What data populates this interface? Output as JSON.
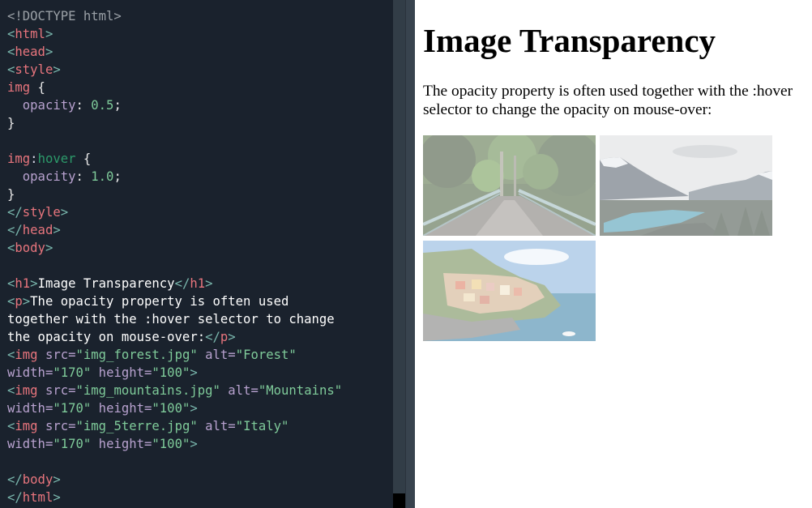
{
  "editor": {
    "lines": [
      [
        {
          "c": "doc",
          "t": "<!DOCTYPE html>"
        }
      ],
      [
        {
          "c": "br",
          "t": "<"
        },
        {
          "c": "tag",
          "t": "html"
        },
        {
          "c": "br",
          "t": ">"
        }
      ],
      [
        {
          "c": "br",
          "t": "<"
        },
        {
          "c": "tag",
          "t": "head"
        },
        {
          "c": "br",
          "t": ">"
        }
      ],
      [
        {
          "c": "br",
          "t": "<"
        },
        {
          "c": "tag",
          "t": "style"
        },
        {
          "c": "br",
          "t": ">"
        }
      ],
      [
        {
          "c": "sel",
          "t": "img"
        },
        {
          "c": "punc",
          "t": " {"
        }
      ],
      [
        {
          "c": "prop",
          "t": "  opacity"
        },
        {
          "c": "punc",
          "t": ": "
        },
        {
          "c": "val",
          "t": "0.5"
        },
        {
          "c": "punc",
          "t": ";"
        }
      ],
      [
        {
          "c": "punc",
          "t": "}"
        }
      ],
      [],
      [
        {
          "c": "sel",
          "t": "img"
        },
        {
          "c": "colon",
          "t": ":"
        },
        {
          "c": "pseudo",
          "t": "hover"
        },
        {
          "c": "punc",
          "t": " {"
        }
      ],
      [
        {
          "c": "prop",
          "t": "  opacity"
        },
        {
          "c": "punc",
          "t": ": "
        },
        {
          "c": "val",
          "t": "1.0"
        },
        {
          "c": "punc",
          "t": ";"
        }
      ],
      [
        {
          "c": "punc",
          "t": "}"
        }
      ],
      [
        {
          "c": "br",
          "t": "</"
        },
        {
          "c": "tag",
          "t": "style"
        },
        {
          "c": "br",
          "t": ">"
        }
      ],
      [
        {
          "c": "br",
          "t": "</"
        },
        {
          "c": "tag",
          "t": "head"
        },
        {
          "c": "br",
          "t": ">"
        }
      ],
      [
        {
          "c": "br",
          "t": "<"
        },
        {
          "c": "tag",
          "t": "body"
        },
        {
          "c": "br",
          "t": ">"
        }
      ],
      [],
      [
        {
          "c": "br",
          "t": "<"
        },
        {
          "c": "tag",
          "t": "h1"
        },
        {
          "c": "br",
          "t": ">"
        },
        {
          "c": "text",
          "t": "Image Transparency"
        },
        {
          "c": "br",
          "t": "</"
        },
        {
          "c": "tag",
          "t": "h1"
        },
        {
          "c": "br",
          "t": ">"
        }
      ],
      [
        {
          "c": "br",
          "t": "<"
        },
        {
          "c": "tag",
          "t": "p"
        },
        {
          "c": "br",
          "t": ">"
        },
        {
          "c": "text",
          "t": "The opacity property is often used"
        }
      ],
      [
        {
          "c": "text",
          "t": "together with the :hover selector to change"
        }
      ],
      [
        {
          "c": "text",
          "t": "the opacity on mouse-over:"
        },
        {
          "c": "br",
          "t": "</"
        },
        {
          "c": "tag",
          "t": "p"
        },
        {
          "c": "br",
          "t": ">"
        }
      ],
      [
        {
          "c": "br",
          "t": "<"
        },
        {
          "c": "tag",
          "t": "img"
        },
        {
          "c": "attr",
          "t": " src"
        },
        {
          "c": "attr",
          "t": "="
        },
        {
          "c": "str",
          "t": "\"img_forest.jpg\""
        },
        {
          "c": "attr",
          "t": " alt"
        },
        {
          "c": "attr",
          "t": "="
        },
        {
          "c": "str",
          "t": "\"Forest\""
        }
      ],
      [
        {
          "c": "attr",
          "t": "width"
        },
        {
          "c": "attr",
          "t": "="
        },
        {
          "c": "str",
          "t": "\"170\""
        },
        {
          "c": "attr",
          "t": " height"
        },
        {
          "c": "attr",
          "t": "="
        },
        {
          "c": "str",
          "t": "\"100\""
        },
        {
          "c": "br",
          "t": ">"
        }
      ],
      [
        {
          "c": "br",
          "t": "<"
        },
        {
          "c": "tag",
          "t": "img"
        },
        {
          "c": "attr",
          "t": " src"
        },
        {
          "c": "attr",
          "t": "="
        },
        {
          "c": "str",
          "t": "\"img_mountains.jpg\""
        },
        {
          "c": "attr",
          "t": " alt"
        },
        {
          "c": "attr",
          "t": "="
        },
        {
          "c": "str",
          "t": "\"Mountains\""
        }
      ],
      [
        {
          "c": "attr",
          "t": "width"
        },
        {
          "c": "attr",
          "t": "="
        },
        {
          "c": "str",
          "t": "\"170\""
        },
        {
          "c": "attr",
          "t": " height"
        },
        {
          "c": "attr",
          "t": "="
        },
        {
          "c": "str",
          "t": "\"100\""
        },
        {
          "c": "br",
          "t": ">"
        }
      ],
      [
        {
          "c": "br",
          "t": "<"
        },
        {
          "c": "tag",
          "t": "img"
        },
        {
          "c": "attr",
          "t": " src"
        },
        {
          "c": "attr",
          "t": "="
        },
        {
          "c": "str",
          "t": "\"img_5terre.jpg\""
        },
        {
          "c": "attr",
          "t": " alt"
        },
        {
          "c": "attr",
          "t": "="
        },
        {
          "c": "str",
          "t": "\"Italy\""
        }
      ],
      [
        {
          "c": "attr",
          "t": "width"
        },
        {
          "c": "attr",
          "t": "="
        },
        {
          "c": "str",
          "t": "\"170\""
        },
        {
          "c": "attr",
          "t": " height"
        },
        {
          "c": "attr",
          "t": "="
        },
        {
          "c": "str",
          "t": "\"100\""
        },
        {
          "c": "br",
          "t": ">"
        }
      ],
      [],
      [
        {
          "c": "br",
          "t": "</"
        },
        {
          "c": "tag",
          "t": "body"
        },
        {
          "c": "br",
          "t": ">"
        }
      ],
      [
        {
          "c": "br",
          "t": "</"
        },
        {
          "c": "tag",
          "t": "html"
        },
        {
          "c": "br",
          "t": ">"
        }
      ]
    ]
  },
  "preview": {
    "heading": "Image Transparency",
    "paragraph": "The opacity property is often used together with the :hover selector to change the opacity on mouse-over:",
    "images": [
      {
        "alt": "Forest",
        "opacity": 0.5
      },
      {
        "alt": "Mountains",
        "opacity": 0.5
      },
      {
        "alt": "Italy",
        "opacity": 0.5
      }
    ]
  },
  "colors": {
    "editor_bg": "#1a222d",
    "tag": "#e8757d",
    "bracket": "#79b6ac",
    "attribute": "#b8a2cf",
    "string": "#7fcb9a",
    "pseudo": "#2c9a6a",
    "divider": "#38434e"
  }
}
